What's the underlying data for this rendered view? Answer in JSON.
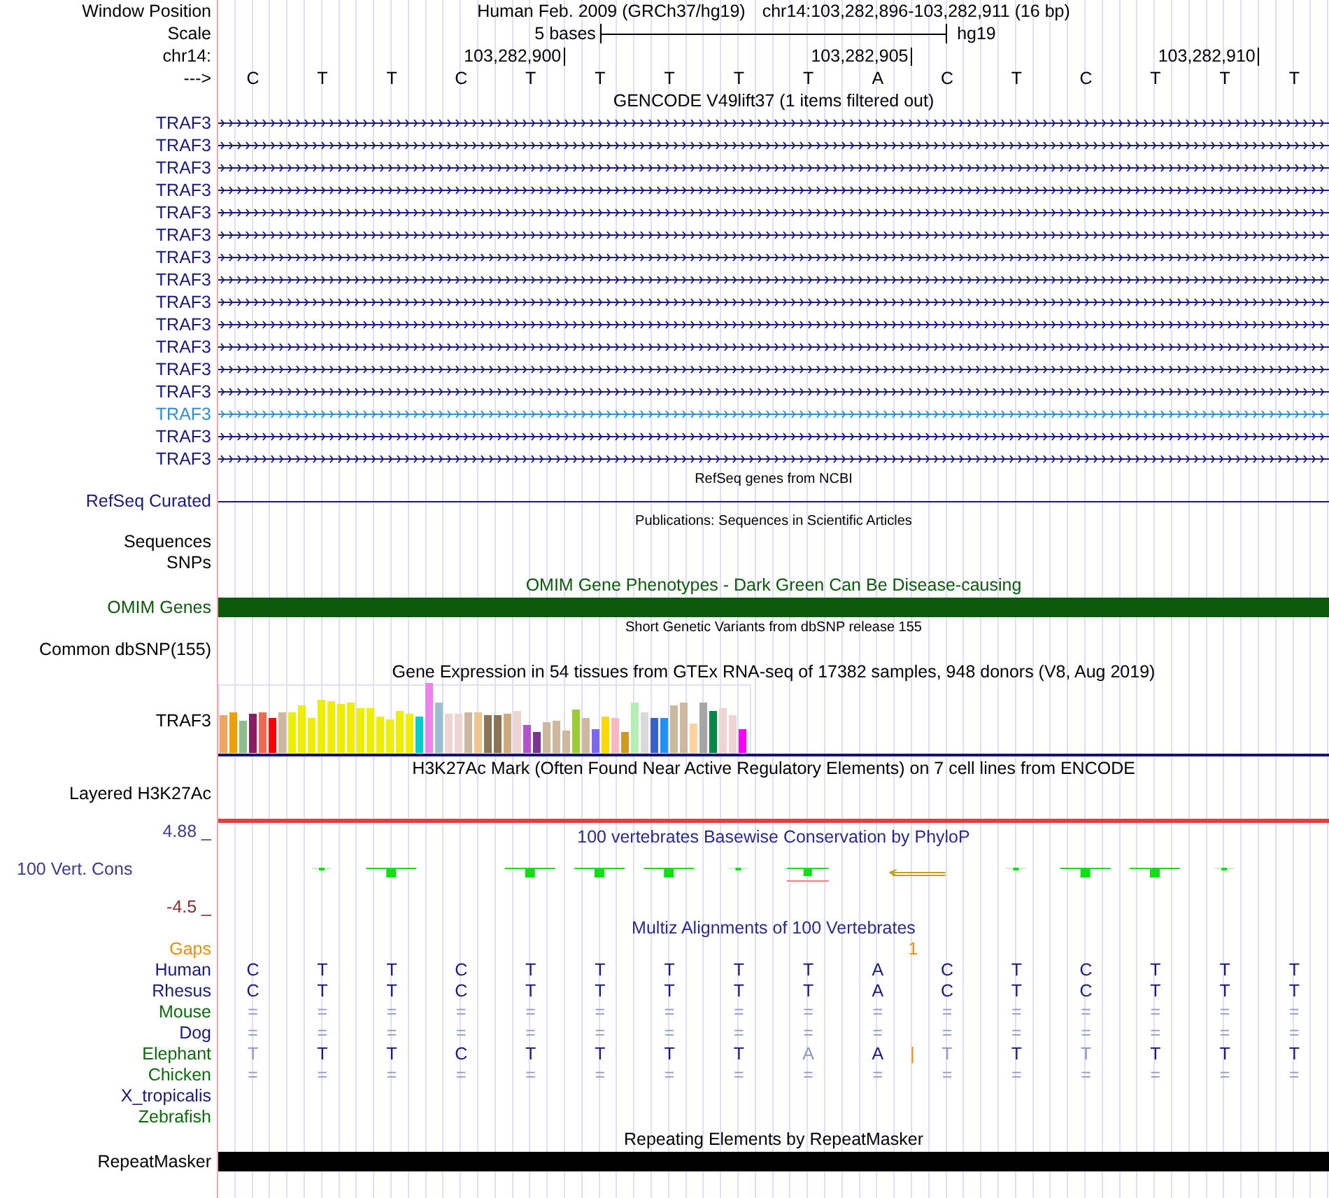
{
  "header": {
    "position_label": "Window Position",
    "assembly": "Human Feb. 2009 (GRCh37/hg19)",
    "position": "chr14:103,282,896-103,282,911 (16 bp)",
    "scale_label": "Scale",
    "scale_text": "5 bases",
    "scale_db": "hg19",
    "chrom_label": "chr14:",
    "position_ticks": [
      "103,282,900",
      "103,282,905",
      "103,282,910"
    ],
    "strand_label": "--->",
    "bases": [
      "C",
      "T",
      "T",
      "C",
      "T",
      "T",
      "T",
      "T",
      "T",
      "A",
      "C",
      "T",
      "C",
      "T",
      "T",
      "T"
    ]
  },
  "tracks": [
    {
      "kind": "genes",
      "title": "GENCODE V49lift37 (1 items filtered out)",
      "items": [
        {
          "label": "TRAF3",
          "color": "#1a1a7a"
        },
        {
          "label": "TRAF3",
          "color": "#1a1a7a"
        },
        {
          "label": "TRAF3",
          "color": "#1a1a7a"
        },
        {
          "label": "TRAF3",
          "color": "#1a1a7a"
        },
        {
          "label": "TRAF3",
          "color": "#1a1a7a"
        },
        {
          "label": "TRAF3",
          "color": "#1a1a7a"
        },
        {
          "label": "TRAF3",
          "color": "#1a1a7a"
        },
        {
          "label": "TRAF3",
          "color": "#1a1a7a"
        },
        {
          "label": "TRAF3",
          "color": "#1a1a7a"
        },
        {
          "label": "TRAF3",
          "color": "#1a1a7a"
        },
        {
          "label": "TRAF3",
          "color": "#1a1a7a"
        },
        {
          "label": "TRAF3",
          "color": "#1a1a7a"
        },
        {
          "label": "TRAF3",
          "color": "#1a1a7a"
        },
        {
          "label": "TRAF3",
          "color": "#2f8fd0"
        },
        {
          "label": "TRAF3",
          "color": "#1a1a7a"
        },
        {
          "label": "TRAF3",
          "color": "#1a1a7a"
        }
      ]
    },
    {
      "kind": "line",
      "title": "RefSeq genes from NCBI",
      "label": "RefSeq Curated",
      "color": "#1a1a7a"
    },
    {
      "kind": "labels",
      "title": "Publications: Sequences in Scientific Articles",
      "labels": [
        "Sequences",
        "SNPs"
      ]
    },
    {
      "kind": "bar",
      "title": "OMIM Gene Phenotypes - Dark Green Can Be Disease-causing",
      "label": "OMIM Genes",
      "color": "#0b5a0b"
    },
    {
      "kind": "label",
      "title": "Short Genetic Variants from dbSNP release 155",
      "label": "Common dbSNP(155)"
    },
    {
      "kind": "gtex",
      "title": "Gene Expression in 54 tissues from GTEx RNA-seq of 17382 samples, 948 donors (V8, Aug 2019)",
      "label": "TRAF3"
    },
    {
      "kind": "layered",
      "title": "H3K27Ac Mark (Often Found Near Active Regulatory Elements) on 7 cell lines from ENCODE",
      "label": "Layered H3K27Ac"
    },
    {
      "kind": "conservation",
      "title": "100 vertebrates Basewise Conservation by PhyloP",
      "label": "100 Vert. Cons",
      "max": "4.88 _",
      "min": "-4.5 _"
    },
    {
      "kind": "multiz",
      "title": "Multiz Alignments of 100 Vertebrates",
      "species": [
        {
          "label": "Gaps",
          "color": "#e8900a",
          "cells": [
            {
              "kind": "empty"
            },
            {
              "kind": "empty"
            },
            {
              "kind": "empty"
            },
            {
              "kind": "empty"
            },
            {
              "kind": "empty"
            },
            {
              "kind": "empty"
            },
            {
              "kind": "empty"
            },
            {
              "kind": "empty"
            },
            {
              "kind": "empty"
            },
            {
              "kind": "empty"
            },
            {
              "kind": "insert",
              "text": "1"
            },
            {
              "kind": "empty"
            },
            {
              "kind": "empty"
            },
            {
              "kind": "empty"
            },
            {
              "kind": "empty"
            },
            {
              "kind": "empty"
            },
            {
              "kind": "empty"
            }
          ]
        },
        {
          "label": "Human",
          "color": "#1a1a7a",
          "cells": [
            {
              "kind": "base",
              "text": "C",
              "faded": false
            },
            {
              "kind": "base",
              "text": "T",
              "faded": false
            },
            {
              "kind": "base",
              "text": "T",
              "faded": false
            },
            {
              "kind": "base",
              "text": "C",
              "faded": false
            },
            {
              "kind": "base",
              "text": "T",
              "faded": false
            },
            {
              "kind": "base",
              "text": "T",
              "faded": false
            },
            {
              "kind": "base",
              "text": "T",
              "faded": false
            },
            {
              "kind": "base",
              "text": "T",
              "faded": false
            },
            {
              "kind": "base",
              "text": "T",
              "faded": false
            },
            {
              "kind": "base",
              "text": "A",
              "faded": false
            },
            {
              "kind": "base",
              "text": "C",
              "faded": false
            },
            {
              "kind": "base",
              "text": "T",
              "faded": false
            },
            {
              "kind": "base",
              "text": "C",
              "faded": false
            },
            {
              "kind": "base",
              "text": "T",
              "faded": false
            },
            {
              "kind": "base",
              "text": "T",
              "faded": false
            },
            {
              "kind": "base",
              "text": "T",
              "faded": false
            }
          ]
        },
        {
          "label": "Rhesus",
          "color": "#1a1a7a",
          "cells": [
            {
              "kind": "base",
              "text": "C",
              "faded": false
            },
            {
              "kind": "base",
              "text": "T",
              "faded": false
            },
            {
              "kind": "base",
              "text": "T",
              "faded": false
            },
            {
              "kind": "base",
              "text": "C",
              "faded": false
            },
            {
              "kind": "base",
              "text": "T",
              "faded": false
            },
            {
              "kind": "base",
              "text": "T",
              "faded": false
            },
            {
              "kind": "base",
              "text": "T",
              "faded": false
            },
            {
              "kind": "base",
              "text": "T",
              "faded": false
            },
            {
              "kind": "base",
              "text": "T",
              "faded": false
            },
            {
              "kind": "base",
              "text": "A",
              "faded": false
            },
            {
              "kind": "base",
              "text": "C",
              "faded": false
            },
            {
              "kind": "base",
              "text": "T",
              "faded": false
            },
            {
              "kind": "base",
              "text": "C",
              "faded": false
            },
            {
              "kind": "base",
              "text": "T",
              "faded": false
            },
            {
              "kind": "base",
              "text": "T",
              "faded": false
            },
            {
              "kind": "base",
              "text": "T",
              "faded": false
            }
          ]
        },
        {
          "label": "Mouse",
          "color": "#0b6a0b",
          "cells": [
            {
              "kind": "base",
              "text": "=",
              "faded": true
            },
            {
              "kind": "base",
              "text": "=",
              "faded": true
            },
            {
              "kind": "base",
              "text": "=",
              "faded": true
            },
            {
              "kind": "base",
              "text": "=",
              "faded": true
            },
            {
              "kind": "base",
              "text": "=",
              "faded": true
            },
            {
              "kind": "base",
              "text": "=",
              "faded": true
            },
            {
              "kind": "base",
              "text": "=",
              "faded": true
            },
            {
              "kind": "base",
              "text": "=",
              "faded": true
            },
            {
              "kind": "base",
              "text": "=",
              "faded": true
            },
            {
              "kind": "base",
              "text": "=",
              "faded": true
            },
            {
              "kind": "base",
              "text": "=",
              "faded": true
            },
            {
              "kind": "base",
              "text": "=",
              "faded": true
            },
            {
              "kind": "base",
              "text": "=",
              "faded": true
            },
            {
              "kind": "base",
              "text": "=",
              "faded": true
            },
            {
              "kind": "base",
              "text": "=",
              "faded": true
            },
            {
              "kind": "base",
              "text": "=",
              "faded": true
            }
          ]
        },
        {
          "label": "Dog",
          "color": "#1a1a7a",
          "cells": [
            {
              "kind": "base",
              "text": "=",
              "faded": true
            },
            {
              "kind": "base",
              "text": "=",
              "faded": true
            },
            {
              "kind": "base",
              "text": "=",
              "faded": true
            },
            {
              "kind": "base",
              "text": "=",
              "faded": true
            },
            {
              "kind": "base",
              "text": "=",
              "faded": true
            },
            {
              "kind": "base",
              "text": "=",
              "faded": true
            },
            {
              "kind": "base",
              "text": "=",
              "faded": true
            },
            {
              "kind": "base",
              "text": "=",
              "faded": true
            },
            {
              "kind": "base",
              "text": "=",
              "faded": true
            },
            {
              "kind": "base",
              "text": "=",
              "faded": true
            },
            {
              "kind": "base",
              "text": "=",
              "faded": true
            },
            {
              "kind": "base",
              "text": "=",
              "faded": true
            },
            {
              "kind": "base",
              "text": "=",
              "faded": true
            },
            {
              "kind": "base",
              "text": "=",
              "faded": true
            },
            {
              "kind": "base",
              "text": "=",
              "faded": true
            },
            {
              "kind": "base",
              "text": "=",
              "faded": true
            }
          ]
        },
        {
          "label": "Elephant",
          "color": "#0b6a0b",
          "cells": [
            {
              "kind": "base",
              "text": "T",
              "faded": true
            },
            {
              "kind": "base",
              "text": "T",
              "faded": false
            },
            {
              "kind": "base",
              "text": "T",
              "faded": false
            },
            {
              "kind": "base",
              "text": "C",
              "faded": false
            },
            {
              "kind": "base",
              "text": "T",
              "faded": false
            },
            {
              "kind": "base",
              "text": "T",
              "faded": false
            },
            {
              "kind": "base",
              "text": "T",
              "faded": false
            },
            {
              "kind": "base",
              "text": "T",
              "faded": false
            },
            {
              "kind": "base",
              "text": "A",
              "faded": true
            },
            {
              "kind": "base",
              "text": "A",
              "faded": false
            },
            {
              "kind": "insert",
              "text": "|"
            },
            {
              "kind": "base",
              "text": "T",
              "faded": true
            },
            {
              "kind": "base",
              "text": "T",
              "faded": false
            },
            {
              "kind": "base",
              "text": "T",
              "faded": true
            },
            {
              "kind": "base",
              "text": "T",
              "faded": false
            },
            {
              "kind": "base",
              "text": "T",
              "faded": false
            },
            {
              "kind": "base",
              "text": "T",
              "faded": false
            }
          ]
        },
        {
          "label": "Chicken",
          "color": "#0b6a0b",
          "cells": [
            {
              "kind": "base",
              "text": "=",
              "faded": true
            },
            {
              "kind": "base",
              "text": "=",
              "faded": true
            },
            {
              "kind": "base",
              "text": "=",
              "faded": true
            },
            {
              "kind": "base",
              "text": "=",
              "faded": true
            },
            {
              "kind": "base",
              "text": "=",
              "faded": true
            },
            {
              "kind": "base",
              "text": "=",
              "faded": true
            },
            {
              "kind": "base",
              "text": "=",
              "faded": true
            },
            {
              "kind": "base",
              "text": "=",
              "faded": true
            },
            {
              "kind": "base",
              "text": "=",
              "faded": true
            },
            {
              "kind": "base",
              "text": "=",
              "faded": true
            },
            {
              "kind": "base",
              "text": "=",
              "faded": true
            },
            {
              "kind": "base",
              "text": "=",
              "faded": true
            },
            {
              "kind": "base",
              "text": "=",
              "faded": true
            },
            {
              "kind": "base",
              "text": "=",
              "faded": true
            },
            {
              "kind": "base",
              "text": "=",
              "faded": true
            },
            {
              "kind": "base",
              "text": "=",
              "faded": true
            }
          ]
        },
        {
          "label": "X_tropicalis",
          "color": "#1a1a7a"
        },
        {
          "label": "Zebrafish",
          "color": "#0b6a0b"
        }
      ]
    },
    {
      "kind": "bar",
      "title": "Repeating Elements by RepeatMasker",
      "label": "RepeatMasker",
      "color": "#000000"
    }
  ]
}
